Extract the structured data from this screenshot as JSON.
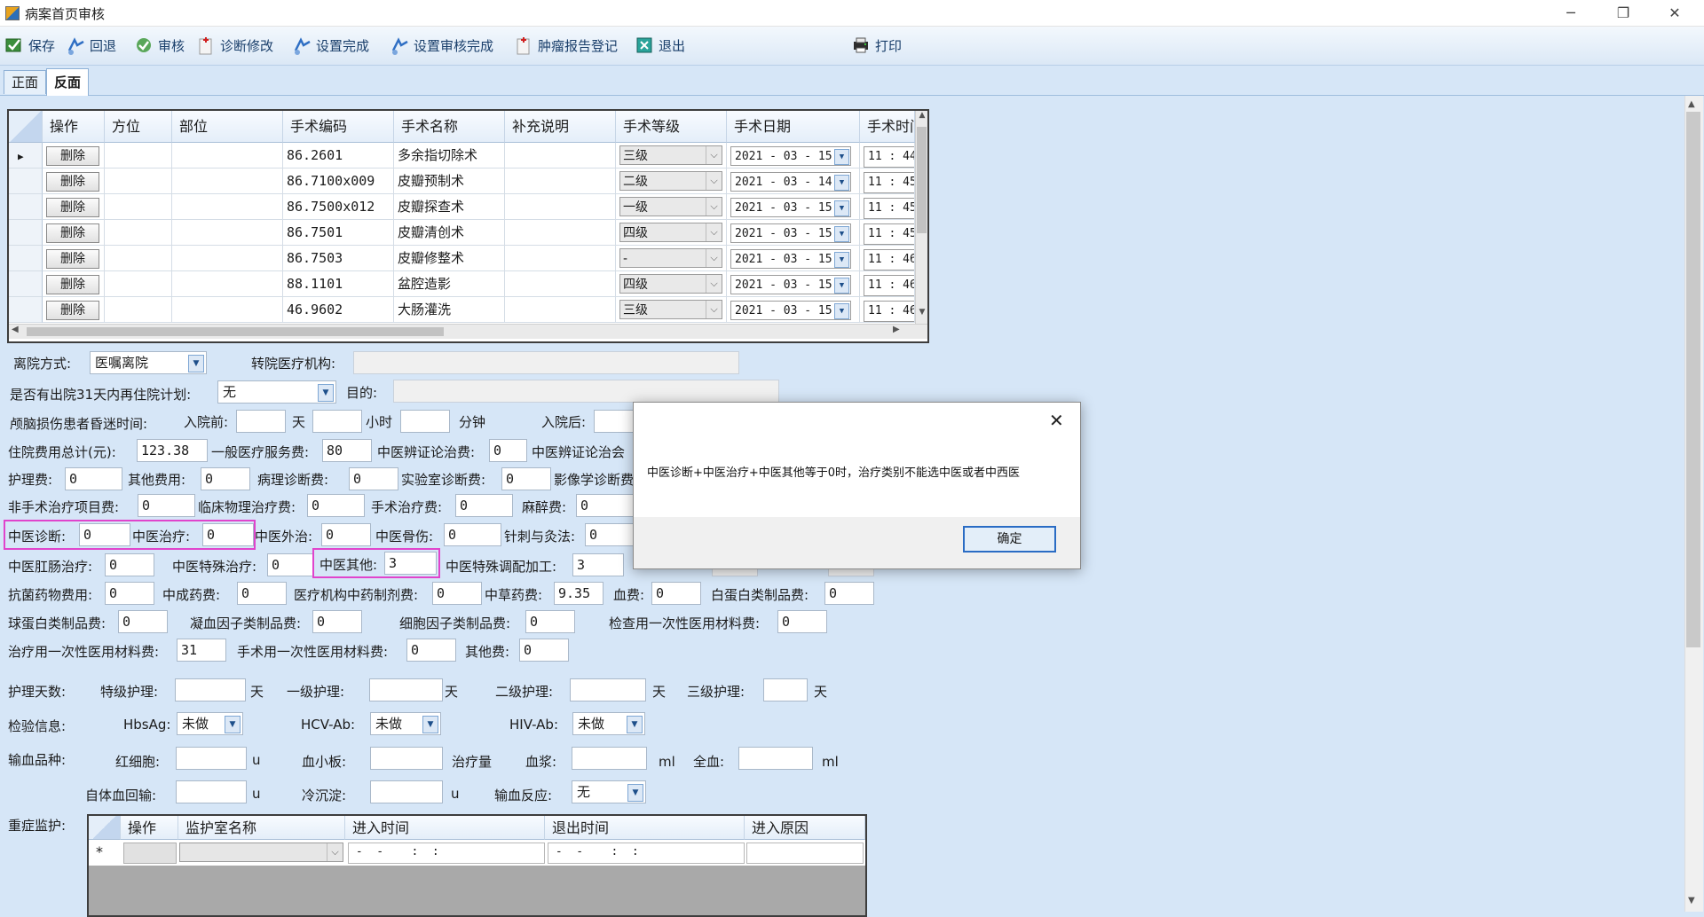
{
  "window": {
    "title": "病案首页审核",
    "minimize": "─",
    "maximize": "❐",
    "close": "✕"
  },
  "toolbar": {
    "save": "保存",
    "back": "回退",
    "audit": "审核",
    "diag_edit": "诊断修改",
    "set_done": "设置完成",
    "set_audit_done": "设置审核完成",
    "tumor_reg": "肿瘤报告登记",
    "exit": "退出",
    "print": "打印"
  },
  "tabs": [
    "正面",
    "反面"
  ],
  "grid": {
    "headers": [
      "操作",
      "方位",
      "部位",
      "手术编码",
      "手术名称",
      "补充说明",
      "手术等级",
      "手术日期",
      "手术时间"
    ],
    "delete_label": "删除",
    "rows": [
      {
        "code": "86.2601",
        "name": "多余指切除术",
        "level": "三级",
        "date": "2021 - 03 - 15",
        "time": "11 : 44"
      },
      {
        "code": "86.7100x009",
        "name": "皮瓣预制术",
        "level": "二级",
        "date": "2021 - 03 - 14",
        "time": "11 : 45"
      },
      {
        "code": "86.7500x012",
        "name": "皮瓣探查术",
        "level": "一级",
        "date": "2021 - 03 - 15",
        "time": "11 : 45"
      },
      {
        "code": "86.7501",
        "name": "皮瓣清创术",
        "level": "四级",
        "date": "2021 - 03 - 15",
        "time": "11 : 45"
      },
      {
        "code": "86.7503",
        "name": "皮瓣修整术",
        "level": "-",
        "date": "2021 - 03 - 15",
        "time": "11 : 46"
      },
      {
        "code": "88.1101",
        "name": "盆腔造影",
        "level": "四级",
        "date": "2021 - 03 - 15",
        "time": "11 : 46"
      },
      {
        "code": "46.9602",
        "name": "大肠灌洗",
        "level": "三级",
        "date": "2021 - 03 - 15",
        "time": "11 : 46"
      }
    ]
  },
  "form": {
    "discharge_label": "离院方式:",
    "discharge_value": "医嘱离院",
    "transfer_label": "转院医疗机构:",
    "readmit_label": "是否有出院31天内再住院计划:",
    "readmit_value": "无",
    "purpose_label": "目的:",
    "coma_label": "颅脑损伤患者昏迷时间:",
    "before_label": "入院前:",
    "day": "天",
    "hour": "小时",
    "minute": "分钟",
    "after_label": "入院后:",
    "total_label": "住院费用总计(元):",
    "total_value": "123.38",
    "general_label": "一般医疗服务费:",
    "general_value": "80",
    "tcm_diag_fee_label": "中医辨证论治费:",
    "tcm_diag_fee_value": "0",
    "tcm_diag_meet_label": "中医辨证论治会",
    "nursing_label": "护理费:",
    "nursing_value": "0",
    "other_label": "其他费用:",
    "other_value": "0",
    "patho_label": "病理诊断费:",
    "patho_value": "0",
    "lab_label": "实验室诊断费:",
    "lab_value": "0",
    "imaging_label": "影像学诊断费",
    "nonsurg_label": "非手术治疗项目费:",
    "nonsurg_value": "0",
    "physio_label": "临床物理治疗费:",
    "physio_value": "0",
    "surgtreat_label": "手术治疗费:",
    "surgtreat_value": "0",
    "anesth_label": "麻醉费:",
    "anesth_value": "0",
    "tcm_diag_label": "中医诊断:",
    "tcm_diag_value": "0",
    "tcm_treat_label": "中医治疗:",
    "tcm_treat_value": "0",
    "tcm_ext_label": "中医外治:",
    "tcm_ext_value": "0",
    "tcm_bone_label": "中医骨伤:",
    "tcm_bone_value": "0",
    "acup_label": "针刺与灸法:",
    "acup_value": "0",
    "tcm_anal_label": "中医肛肠治疗:",
    "tcm_anal_value": "0",
    "tcm_special_label": "中医特殊治疗:",
    "tcm_special_value": "0",
    "tcm_other_label": "中医其他:",
    "tcm_other_value": "3",
    "tcm_prep_label": "中医特殊调配加工:",
    "tcm_prep_value": "3",
    "antibio_label": "抗菌药物费用:",
    "antibio_value": "0",
    "patent_label": "中成药费:",
    "patent_value": "0",
    "inst_prep_label": "医疗机构中药制剂费:",
    "inst_prep_value": "0",
    "herb_label": "中草药费:",
    "herb_value": "9.35",
    "blood_label": "血费:",
    "blood_value": "0",
    "albumin_label": "白蛋白类制品费:",
    "albumin_value": "0",
    "globulin_label": "球蛋白类制品费:",
    "globulin_value": "0",
    "coag_label": "凝血因子类制品费:",
    "coag_value": "0",
    "cytokine_label": "细胞因子类制品费:",
    "cytokine_value": "0",
    "exam_disp_label": "检查用一次性医用材料费:",
    "exam_disp_value": "0",
    "treat_disp_label": "治疗用一次性医用材料费:",
    "treat_disp_value": "31",
    "surg_disp_label": "手术用一次性医用材料费:",
    "surg_disp_value": "0",
    "misc_label": "其他费:",
    "misc_value": "0",
    "nurse_days_label": "护理天数:",
    "special_nurse": "特级护理:",
    "first_nurse": "一级护理:",
    "second_nurse": "二级护理:",
    "third_nurse": "三级护理:",
    "lab_info_label": "检验信息:",
    "hbsag_label": "HbsAg:",
    "hcv_label": "HCV-Ab:",
    "hiv_label": "HIV-Ab:",
    "not_done": "未做",
    "transfusion_label": "输血品种:",
    "rbc_label": "红细胞:",
    "platelet_label": "血小板:",
    "treat_amount": "治疗量",
    "plasma_label": "血浆:",
    "whole_label": "全血:",
    "unit_u": "u",
    "unit_ml": "ml",
    "autologous_label": "自体血回输:",
    "cryo_label": "冷沉淀:",
    "reaction_label": "输血反应:",
    "reaction_value": "无",
    "icu_label": "重症监护:"
  },
  "icu_grid": {
    "headers": [
      "操作",
      "监护室名称",
      "进入时间",
      "退出时间",
      "进入原因"
    ],
    "new_row_marker": "*",
    "time_placeholder": " -  -    :  :"
  },
  "dialog": {
    "message": "中医诊断+中医治疗+中医其他等于0时，治疗类别不能选中医或者中西医",
    "ok": "确定",
    "close": "✕"
  },
  "colors": {
    "highlight": "#e044cc",
    "background": "#d6e6f7",
    "dialog_border": "#2a6cc4"
  }
}
